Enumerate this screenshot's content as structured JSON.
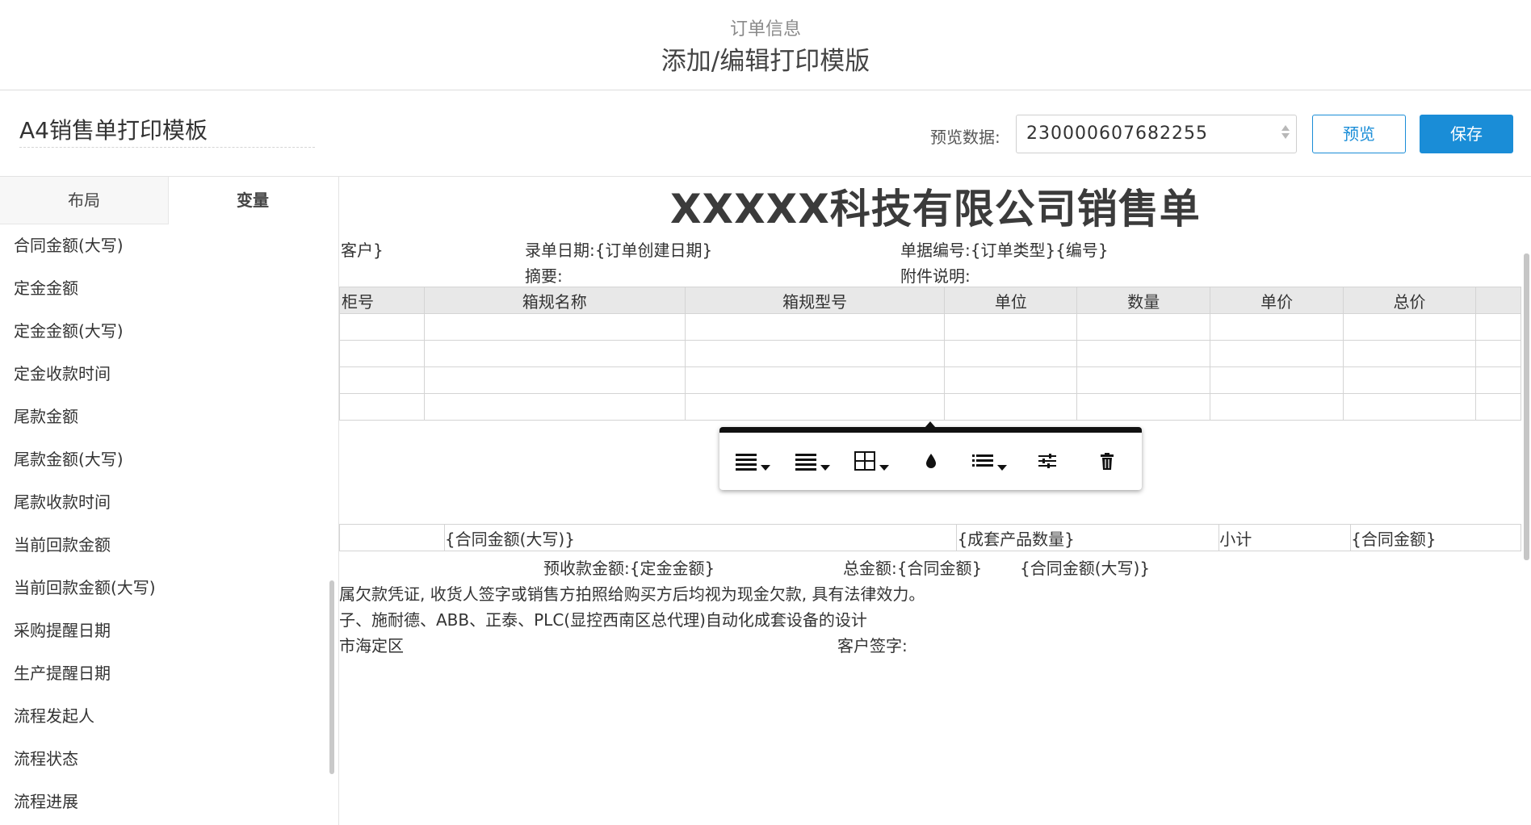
{
  "header": {
    "breadcrumb": "订单信息",
    "title": "添加/编辑打印模版"
  },
  "toolbar": {
    "template_name": "A4销售单打印模板",
    "preview_label": "预览数据:",
    "preview_value": "230000607682255",
    "preview_button": "预览",
    "save_button": "保存"
  },
  "sidebar": {
    "tabs": [
      {
        "label": "布局"
      },
      {
        "label": "变量"
      }
    ],
    "active_tab": "变量",
    "variables": [
      "合同金额(大写)",
      "定金金额",
      "定金金额(大写)",
      "定金收款时间",
      "尾款金额",
      "尾款金额(大写)",
      "尾款收款时间",
      "当前回款金额",
      "当前回款金额(大写)",
      "采购提醒日期",
      "生产提醒日期",
      "流程发起人",
      "流程状态",
      "流程进展"
    ]
  },
  "document": {
    "title": "XXXXX科技有限公司销售单",
    "customer": "客户}",
    "entry_date": "录单日期:{订单创建日期}",
    "doc_number": "单据编号:{订单类型}{编号}",
    "summary": "摘要:",
    "attachment": "附件说明:",
    "table_headers": [
      "柜号",
      "箱规名称",
      "箱规型号",
      "单位",
      "数量",
      "单价",
      "总价"
    ],
    "summary_row": {
      "contract_amount_cn": "{合同金额(大写)}",
      "package_qty": "{成套产品数量}",
      "subtotal_label": "小计",
      "contract_amount": "{合同金额}"
    },
    "deposit_line": "预收款金额:{定金金额}",
    "total_line": "总金额:{合同金额}",
    "total_cn": "{合同金额(大写)}",
    "notice": "属欠款凭证, 收货人签字或销售方拍照给购买方后均视为现金欠款, 具有法律效力。",
    "products": "子、施耐德、ABB、正泰、PLC(显控西南区总代理)自动化成套设备的设计",
    "address": "市海定区",
    "customer_sign": "客户签字:"
  },
  "format_toolbar": {
    "tools": [
      "align-icon",
      "line-spacing-icon",
      "table-grid-icon",
      "color-drop-icon",
      "list-icon",
      "settings-sliders-icon",
      "trash-icon"
    ]
  },
  "colors": {
    "accent": "#1a8dd7",
    "table_header_bg": "#e8e8e8"
  }
}
